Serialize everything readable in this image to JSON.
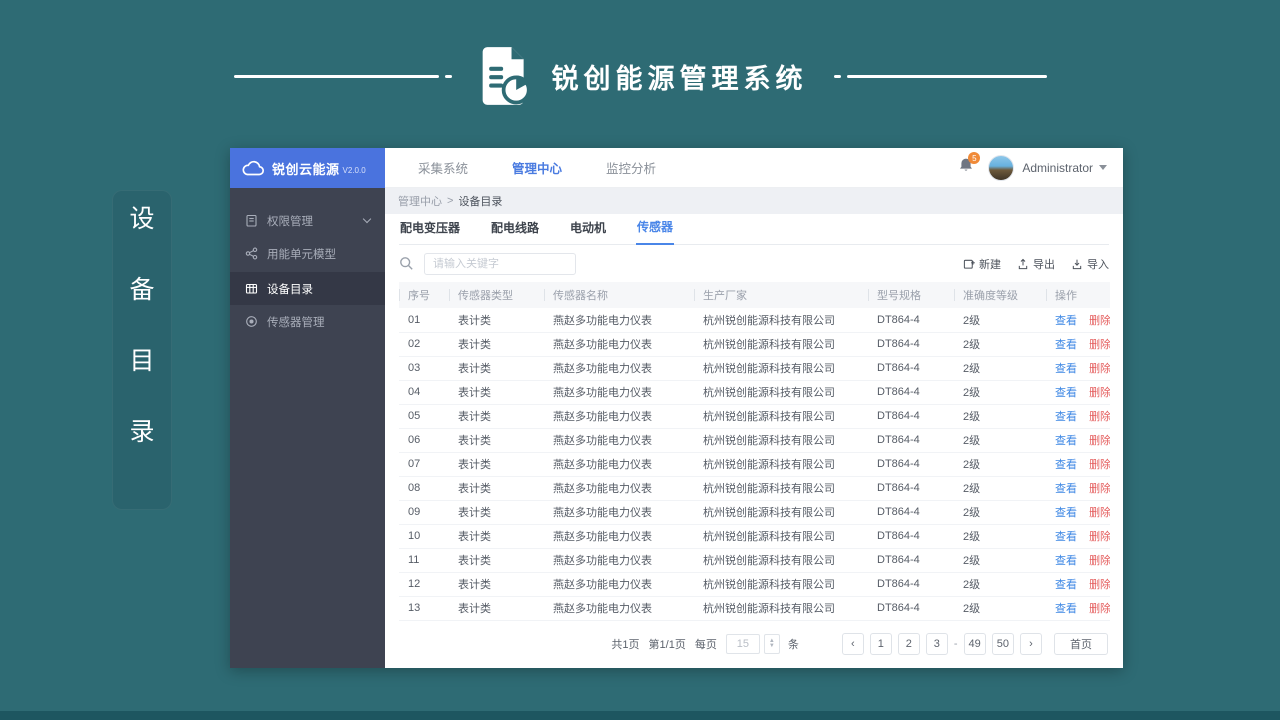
{
  "banner": {
    "title": "锐创能源管理系统"
  },
  "side_label": {
    "chars": [
      "设",
      "备",
      "目",
      "录"
    ]
  },
  "app": {
    "sidebar": {
      "logo_text": "锐创云能源",
      "version": "V2.0.0",
      "items": [
        {
          "label": "权限管理"
        },
        {
          "label": "用能单元模型"
        },
        {
          "label": "设备目录"
        },
        {
          "label": "传感器管理"
        }
      ]
    },
    "topbar": {
      "nav": [
        {
          "label": "采集系统"
        },
        {
          "label": "管理中心"
        },
        {
          "label": "监控分析"
        }
      ],
      "notification_badge": "5",
      "username": "Administrator"
    },
    "breadcrumb": {
      "parent": "管理中心",
      "separator": ">",
      "current": "设备目录"
    },
    "tabs": [
      {
        "label": "配电变压器"
      },
      {
        "label": "配电线路"
      },
      {
        "label": "电动机"
      },
      {
        "label": "传感器"
      }
    ],
    "toolbar": {
      "search_placeholder": "请输入关键字",
      "new_label": "新建",
      "export_label": "导出",
      "import_label": "导入"
    },
    "table": {
      "columns": [
        "序号",
        "传感器类型",
        "传感器名称",
        "生产厂家",
        "型号规格",
        "准确度等级",
        "操作"
      ],
      "view_label": "查看",
      "delete_label": "删除",
      "rows": [
        {
          "no": "01",
          "type": "表计类",
          "name": "燕赵多功能电力仪表",
          "maker": "杭州锐创能源科技有限公司",
          "model": "DT864-4",
          "grade": "2级"
        },
        {
          "no": "02",
          "type": "表计类",
          "name": "燕赵多功能电力仪表",
          "maker": "杭州锐创能源科技有限公司",
          "model": "DT864-4",
          "grade": "2级"
        },
        {
          "no": "03",
          "type": "表计类",
          "name": "燕赵多功能电力仪表",
          "maker": "杭州锐创能源科技有限公司",
          "model": "DT864-4",
          "grade": "2级"
        },
        {
          "no": "04",
          "type": "表计类",
          "name": "燕赵多功能电力仪表",
          "maker": "杭州锐创能源科技有限公司",
          "model": "DT864-4",
          "grade": "2级"
        },
        {
          "no": "05",
          "type": "表计类",
          "name": "燕赵多功能电力仪表",
          "maker": "杭州锐创能源科技有限公司",
          "model": "DT864-4",
          "grade": "2级"
        },
        {
          "no": "06",
          "type": "表计类",
          "name": "燕赵多功能电力仪表",
          "maker": "杭州锐创能源科技有限公司",
          "model": "DT864-4",
          "grade": "2级"
        },
        {
          "no": "07",
          "type": "表计类",
          "name": "燕赵多功能电力仪表",
          "maker": "杭州锐创能源科技有限公司",
          "model": "DT864-4",
          "grade": "2级"
        },
        {
          "no": "08",
          "type": "表计类",
          "name": "燕赵多功能电力仪表",
          "maker": "杭州锐创能源科技有限公司",
          "model": "DT864-4",
          "grade": "2级"
        },
        {
          "no": "09",
          "type": "表计类",
          "name": "燕赵多功能电力仪表",
          "maker": "杭州锐创能源科技有限公司",
          "model": "DT864-4",
          "grade": "2级"
        },
        {
          "no": "10",
          "type": "表计类",
          "name": "燕赵多功能电力仪表",
          "maker": "杭州锐创能源科技有限公司",
          "model": "DT864-4",
          "grade": "2级"
        },
        {
          "no": "11",
          "type": "表计类",
          "name": "燕赵多功能电力仪表",
          "maker": "杭州锐创能源科技有限公司",
          "model": "DT864-4",
          "grade": "2级"
        },
        {
          "no": "12",
          "type": "表计类",
          "name": "燕赵多功能电力仪表",
          "maker": "杭州锐创能源科技有限公司",
          "model": "DT864-4",
          "grade": "2级"
        },
        {
          "no": "13",
          "type": "表计类",
          "name": "燕赵多功能电力仪表",
          "maker": "杭州锐创能源科技有限公司",
          "model": "DT864-4",
          "grade": "2级"
        }
      ]
    },
    "pagination": {
      "total_pages": "共1页",
      "current_page": "第1/1页",
      "per_page_label": "每页",
      "per_page_value": "15",
      "unit_label": "条",
      "prev_icon": "‹",
      "next_icon": "›",
      "pages": [
        "1",
        "2",
        "3",
        "-",
        "49",
        "50"
      ],
      "first_label": "首页"
    }
  },
  "colors": {
    "page_teal": "#2e6b74",
    "footer_teal": "#1d5660",
    "logo_blue": "#4a73de",
    "accent_blue": "#4a86e8",
    "danger_red": "#e45b5b",
    "badge_orange": "#f08a38",
    "sidebar_dark": "#3e4351"
  }
}
